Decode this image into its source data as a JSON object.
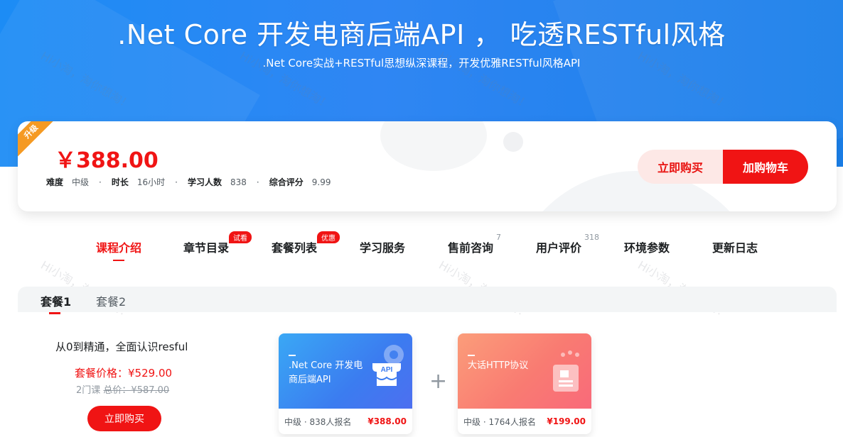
{
  "hero": {
    "title": ".Net Core 开发电商后端API ， 吃透RESTful风格",
    "subtitle": ".Net Core实战+RESTful思想纵深课程，开发优雅RESTful风格API"
  },
  "watermark_text": "Hi小淘，淘你想淘！",
  "price_card": {
    "ribbon": "升级",
    "price": "￥388.00",
    "meta": [
      {
        "key": "难度",
        "value": "中级"
      },
      {
        "key": "时长",
        "value": "16小时"
      },
      {
        "key": "学习人数",
        "value": "838"
      },
      {
        "key": "综合评分",
        "value": "9.99"
      }
    ],
    "buy_now": "立即购买",
    "add_cart": "加购物车"
  },
  "tabs": [
    {
      "label": "课程介绍",
      "active": true
    },
    {
      "label": "章节目录",
      "badge": "试看"
    },
    {
      "label": "套餐列表",
      "badge": "优惠"
    },
    {
      "label": "学习服务"
    },
    {
      "label": "售前咨询",
      "count": "7"
    },
    {
      "label": "用户评价",
      "count": "318"
    },
    {
      "label": "环境参数"
    },
    {
      "label": "更新日志"
    }
  ],
  "packages": {
    "tabs": [
      "套餐1",
      "套餐2"
    ],
    "desc": "从0到精通，全面认识resful",
    "price": "套餐价格：¥529.00",
    "count": "2门课",
    "orig": "总价：¥587.00",
    "buy": "立即购买",
    "plus": "+",
    "courses": [
      {
        "title": ".Net Core 开发电商后端API",
        "level": "中级",
        "enrolled": "· 838人报名",
        "price": "¥388.00",
        "icon_text": "API"
      },
      {
        "title": "大话HTTP协议",
        "level": "中级",
        "enrolled": "· 1764人报名",
        "price": "¥199.00"
      }
    ]
  },
  "colors": {
    "brand_red": "#f01414",
    "hero_blue": "#1c8cf5",
    "ribbon_orange": "#f59a23"
  }
}
